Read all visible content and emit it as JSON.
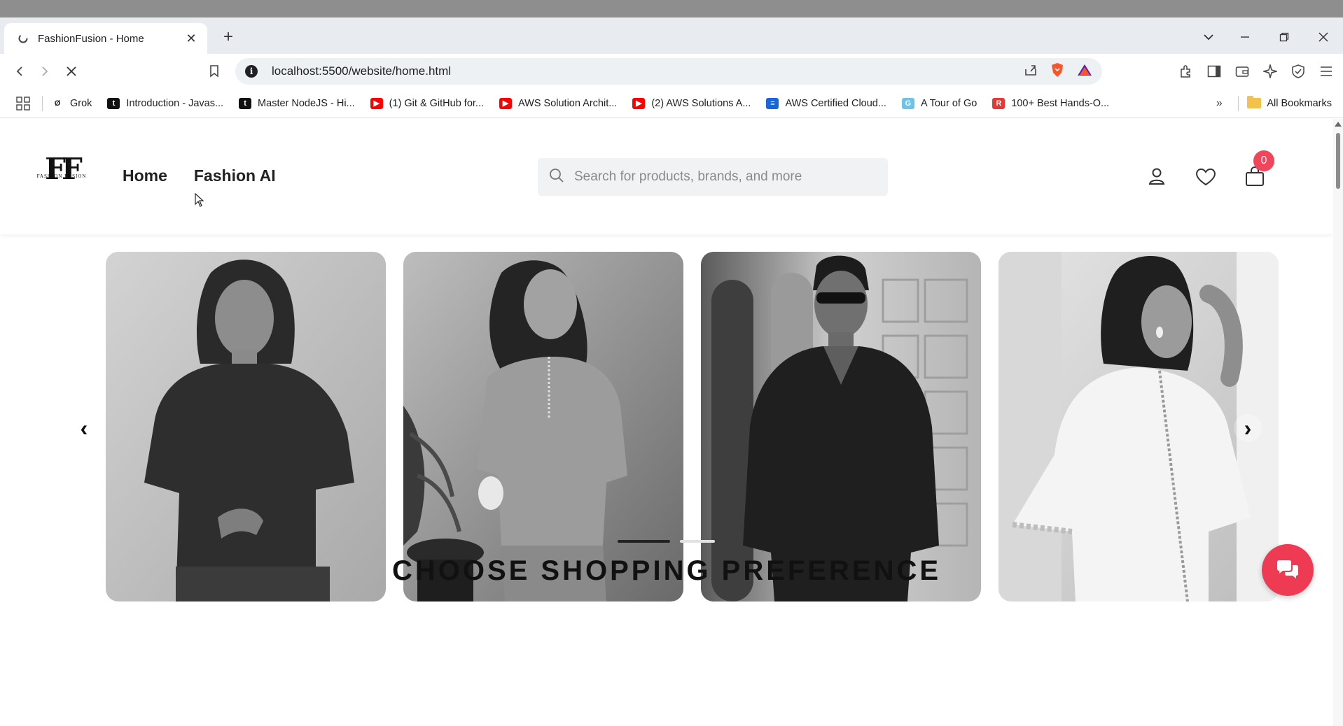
{
  "browser": {
    "tab_title": "FashionFusion - Home",
    "url": "localhost:5500/website/home.html",
    "bookmarks": [
      {
        "label": "Grok",
        "icon": "grok-icon",
        "color": "#222222",
        "glyph": "Ø"
      },
      {
        "label": "Introduction - Javas...",
        "icon": "t-icon",
        "color": "#111111",
        "glyph": "t"
      },
      {
        "label": "Master NodeJS - Hi...",
        "icon": "t-icon",
        "color": "#111111",
        "glyph": "t"
      },
      {
        "label": "(1) Git & GitHub for...",
        "icon": "youtube-icon",
        "color": "#ff0000",
        "glyph": "▶"
      },
      {
        "label": "AWS Solution Archit...",
        "icon": "youtube-icon",
        "color": "#ff0000",
        "glyph": "▶"
      },
      {
        "label": "(2) AWS Solutions A...",
        "icon": "youtube-icon",
        "color": "#ff0000",
        "glyph": "▶"
      },
      {
        "label": "AWS Certified Cloud...",
        "icon": "doc-icon",
        "color": "#1a66d6",
        "glyph": "≡"
      },
      {
        "label": "A Tour of Go",
        "icon": "gopher-icon",
        "color": "#6cc4e6",
        "glyph": "G"
      },
      {
        "label": "100+ Best Hands-O...",
        "icon": "r-icon",
        "color": "#e53935",
        "glyph": "R"
      }
    ],
    "all_bookmarks_label": "All Bookmarks"
  },
  "site": {
    "logo_mark": "FF",
    "logo_sub": "Fashion Fusion",
    "nav": {
      "home": "Home",
      "fashion_ai": "Fashion AI"
    },
    "search_placeholder": "Search for products, brands, and more",
    "cart_count": "0",
    "carousel": {
      "prev": "‹",
      "next": "›",
      "slides": [
        {
          "name": "woman-black-oversized-tee"
        },
        {
          "name": "woman-embroidered-kurta"
        },
        {
          "name": "man-dark-shirt-sunglasses"
        },
        {
          "name": "woman-white-lace-top"
        }
      ],
      "active_dot": 1,
      "dot_count": 2
    },
    "section_title": "CHOOSE SHOPPING PREFERENCE"
  },
  "colors": {
    "accent": "#ee3b53",
    "badge": "#f0455b"
  }
}
